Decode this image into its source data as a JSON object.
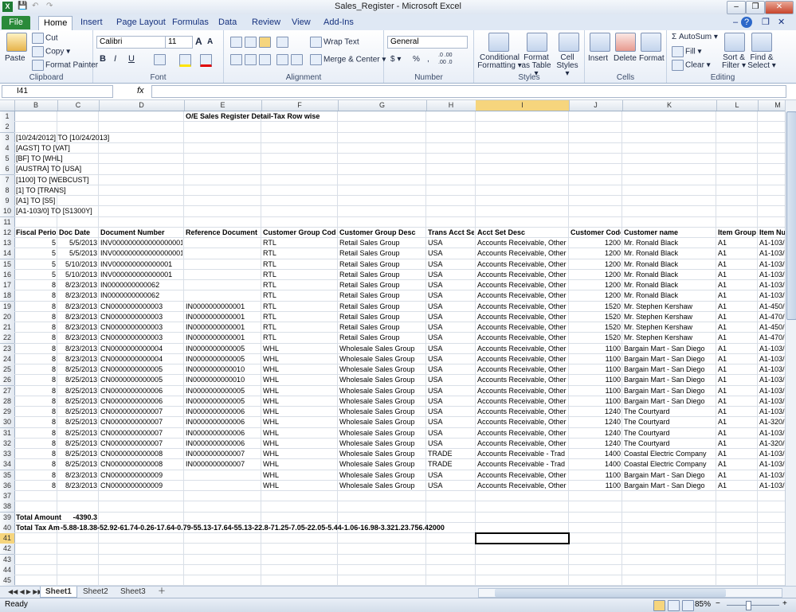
{
  "window": {
    "title": "Sales_Register  -  Microsoft Excel",
    "minimize": "–",
    "restore": "❐",
    "close": "✕",
    "ribbon_min": "–",
    "help": "?",
    "ribbon_restore": "❐",
    "ribbon_close": "✕"
  },
  "tabs": [
    "File",
    "Home",
    "Insert",
    "Page Layout",
    "Formulas",
    "Data",
    "Review",
    "View",
    "Add-Ins"
  ],
  "ribbon": {
    "clipboard": {
      "label": "Clipboard",
      "paste": "Paste",
      "cut": "Cut",
      "copy": "Copy ▾",
      "format_painter": "Format Painter"
    },
    "font": {
      "label": "Font",
      "name": "Calibri",
      "size": "11",
      "grow": "A",
      "shrink": "A",
      "bold": "B",
      "italic": "I",
      "underline": "U"
    },
    "alignment": {
      "label": "Alignment",
      "wrap": "Wrap Text",
      "merge": "Merge & Center ▾"
    },
    "number": {
      "label": "Number",
      "format": "General",
      "currency": "$ ▾",
      "percent": "%",
      "comma": ",",
      "inc_dec": ".0 .00",
      "dec_dec": ".00 .0"
    },
    "styles": {
      "label": "Styles",
      "conditional": "Conditional Formatting ▾",
      "format_table": "Format as Table ▾",
      "cell_styles": "Cell Styles ▾"
    },
    "cells": {
      "label": "Cells",
      "insert": "Insert",
      "delete": "Delete",
      "format": "Format"
    },
    "editing": {
      "label": "Editing",
      "autosum": "Σ AutoSum ▾",
      "fill": "Fill ▾",
      "clear": "Clear ▾",
      "sort": "Sort & Filter ▾",
      "find": "Find & Select ▾"
    }
  },
  "formula_bar": {
    "name_box": "I41",
    "fx": "fx",
    "value": ""
  },
  "columns": [
    "B",
    "C",
    "D",
    "E",
    "F",
    "G",
    "H",
    "I",
    "J",
    "K",
    "L",
    "M"
  ],
  "rows": [
    {
      "n": "1",
      "cells": {
        "E": "O/E Sales Register Detail-Tax Row wise"
      }
    },
    {
      "n": "2",
      "cells": {}
    },
    {
      "n": "3",
      "cells": {
        "B": "[10/24/2012] TO [10/24/2013]"
      }
    },
    {
      "n": "4",
      "cells": {
        "B": "[AGST] TO [VAT]"
      }
    },
    {
      "n": "5",
      "cells": {
        "B": "[BF] TO [WHL]"
      }
    },
    {
      "n": "6",
      "cells": {
        "B": "[AUSTRA] TO [USA]"
      }
    },
    {
      "n": "7",
      "cells": {
        "B": "[1100] TO [WEBCUST]"
      }
    },
    {
      "n": "8",
      "cells": {
        "B": "[1] TO [TRANS]"
      }
    },
    {
      "n": "9",
      "cells": {
        "B": "[A1] TO [S5]"
      }
    },
    {
      "n": "10",
      "cells": {
        "B": "[A1-103/0] TO [S1300Y]"
      }
    },
    {
      "n": "11",
      "cells": {}
    },
    {
      "n": "12",
      "cells": {
        "B": "Fiscal Period",
        "C": "Doc Date",
        "D": "Document Number",
        "E": "Reference Document Nu",
        "F": "Customer Group Code",
        "G": "Customer Group Desc",
        "H": "Trans Acct Set",
        "I": "Acct Set Desc",
        "J": "Customer Code",
        "K": "Customer name",
        "L": "Item Group",
        "M": "Item Nu"
      }
    },
    {
      "n": "13",
      "cells": {
        "B": "5",
        "C": "5/5/2013",
        "D": "INV000000000000000001",
        "E": "",
        "F": "RTL",
        "G": "Retail Sales Group",
        "H": "USA",
        "I": "Accounts Receivable, Other",
        "J": "1200",
        "K": "Mr. Ronald Black",
        "L": "A1",
        "M": "A1-103/"
      }
    },
    {
      "n": "14",
      "cells": {
        "B": "5",
        "C": "5/5/2013",
        "D": "INV000000000000000001",
        "E": "",
        "F": "RTL",
        "G": "Retail Sales Group",
        "H": "USA",
        "I": "Accounts Receivable, Other",
        "J": "1200",
        "K": "Mr. Ronald Black",
        "L": "A1",
        "M": "A1-103/"
      }
    },
    {
      "n": "15",
      "cells": {
        "B": "5",
        "C": "5/10/2013",
        "D": "INV000000000000001",
        "E": "",
        "F": "RTL",
        "G": "Retail Sales Group",
        "H": "USA",
        "I": "Accounts Receivable, Other",
        "J": "1200",
        "K": "Mr. Ronald Black",
        "L": "A1",
        "M": "A1-103/"
      }
    },
    {
      "n": "16",
      "cells": {
        "B": "5",
        "C": "5/10/2013",
        "D": "INV000000000000001",
        "E": "",
        "F": "RTL",
        "G": "Retail Sales Group",
        "H": "USA",
        "I": "Accounts Receivable, Other",
        "J": "1200",
        "K": "Mr. Ronald Black",
        "L": "A1",
        "M": "A1-103/"
      }
    },
    {
      "n": "17",
      "cells": {
        "B": "8",
        "C": "8/23/2013",
        "D": "IN0000000000062",
        "E": "",
        "F": "RTL",
        "G": "Retail Sales Group",
        "H": "USA",
        "I": "Accounts Receivable, Other",
        "J": "1200",
        "K": "Mr. Ronald Black",
        "L": "A1",
        "M": "A1-103/"
      }
    },
    {
      "n": "18",
      "cells": {
        "B": "8",
        "C": "8/23/2013",
        "D": "IN0000000000062",
        "E": "",
        "F": "RTL",
        "G": "Retail Sales Group",
        "H": "USA",
        "I": "Accounts Receivable, Other",
        "J": "1200",
        "K": "Mr. Ronald Black",
        "L": "A1",
        "M": "A1-103/"
      }
    },
    {
      "n": "19",
      "cells": {
        "B": "8",
        "C": "8/23/2013",
        "D": "CN0000000000003",
        "E": "IN0000000000001",
        "F": "RTL",
        "G": "Retail Sales Group",
        "H": "USA",
        "I": "Accounts Receivable, Other",
        "J": "1520",
        "K": "Mr. Stephen Kershaw",
        "L": "A1",
        "M": "A1-450/"
      }
    },
    {
      "n": "20",
      "cells": {
        "B": "8",
        "C": "8/23/2013",
        "D": "CN0000000000003",
        "E": "IN0000000000001",
        "F": "RTL",
        "G": "Retail Sales Group",
        "H": "USA",
        "I": "Accounts Receivable, Other",
        "J": "1520",
        "K": "Mr. Stephen Kershaw",
        "L": "A1",
        "M": "A1-470/"
      }
    },
    {
      "n": "21",
      "cells": {
        "B": "8",
        "C": "8/23/2013",
        "D": "CN0000000000003",
        "E": "IN0000000000001",
        "F": "RTL",
        "G": "Retail Sales Group",
        "H": "USA",
        "I": "Accounts Receivable, Other",
        "J": "1520",
        "K": "Mr. Stephen Kershaw",
        "L": "A1",
        "M": "A1-450/"
      }
    },
    {
      "n": "22",
      "cells": {
        "B": "8",
        "C": "8/23/2013",
        "D": "CN0000000000003",
        "E": "IN0000000000001",
        "F": "RTL",
        "G": "Retail Sales Group",
        "H": "USA",
        "I": "Accounts Receivable, Other",
        "J": "1520",
        "K": "Mr. Stephen Kershaw",
        "L": "A1",
        "M": "A1-470/"
      }
    },
    {
      "n": "23",
      "cells": {
        "B": "8",
        "C": "8/23/2013",
        "D": "CN0000000000004",
        "E": "IN0000000000005",
        "F": "WHL",
        "G": "Wholesale Sales Group",
        "H": "USA",
        "I": "Accounts Receivable, Other",
        "J": "1100",
        "K": "Bargain Mart - San Diego",
        "L": "A1",
        "M": "A1-103/"
      }
    },
    {
      "n": "24",
      "cells": {
        "B": "8",
        "C": "8/23/2013",
        "D": "CN0000000000004",
        "E": "IN0000000000005",
        "F": "WHL",
        "G": "Wholesale Sales Group",
        "H": "USA",
        "I": "Accounts Receivable, Other",
        "J": "1100",
        "K": "Bargain Mart - San Diego",
        "L": "A1",
        "M": "A1-103/"
      }
    },
    {
      "n": "25",
      "cells": {
        "B": "8",
        "C": "8/25/2013",
        "D": "CN0000000000005",
        "E": "IN0000000000010",
        "F": "WHL",
        "G": "Wholesale Sales Group",
        "H": "USA",
        "I": "Accounts Receivable, Other",
        "J": "1100",
        "K": "Bargain Mart - San Diego",
        "L": "A1",
        "M": "A1-103/"
      }
    },
    {
      "n": "26",
      "cells": {
        "B": "8",
        "C": "8/25/2013",
        "D": "CN0000000000005",
        "E": "IN0000000000010",
        "F": "WHL",
        "G": "Wholesale Sales Group",
        "H": "USA",
        "I": "Accounts Receivable, Other",
        "J": "1100",
        "K": "Bargain Mart - San Diego",
        "L": "A1",
        "M": "A1-103/"
      }
    },
    {
      "n": "27",
      "cells": {
        "B": "8",
        "C": "8/25/2013",
        "D": "CN0000000000006",
        "E": "IN0000000000005",
        "F": "WHL",
        "G": "Wholesale Sales Group",
        "H": "USA",
        "I": "Accounts Receivable, Other",
        "J": "1100",
        "K": "Bargain Mart - San Diego",
        "L": "A1",
        "M": "A1-103/"
      }
    },
    {
      "n": "28",
      "cells": {
        "B": "8",
        "C": "8/25/2013",
        "D": "CN0000000000006",
        "E": "IN0000000000005",
        "F": "WHL",
        "G": "Wholesale Sales Group",
        "H": "USA",
        "I": "Accounts Receivable, Other",
        "J": "1100",
        "K": "Bargain Mart - San Diego",
        "L": "A1",
        "M": "A1-103/"
      }
    },
    {
      "n": "29",
      "cells": {
        "B": "8",
        "C": "8/25/2013",
        "D": "CN0000000000007",
        "E": "IN0000000000006",
        "F": "WHL",
        "G": "Wholesale Sales Group",
        "H": "USA",
        "I": "Accounts Receivable, Other",
        "J": "1240",
        "K": "The Courtyard",
        "L": "A1",
        "M": "A1-103/"
      }
    },
    {
      "n": "30",
      "cells": {
        "B": "8",
        "C": "8/25/2013",
        "D": "CN0000000000007",
        "E": "IN0000000000006",
        "F": "WHL",
        "G": "Wholesale Sales Group",
        "H": "USA",
        "I": "Accounts Receivable, Other",
        "J": "1240",
        "K": "The Courtyard",
        "L": "A1",
        "M": "A1-320/"
      }
    },
    {
      "n": "31",
      "cells": {
        "B": "8",
        "C": "8/25/2013",
        "D": "CN0000000000007",
        "E": "IN0000000000006",
        "F": "WHL",
        "G": "Wholesale Sales Group",
        "H": "USA",
        "I": "Accounts Receivable, Other",
        "J": "1240",
        "K": "The Courtyard",
        "L": "A1",
        "M": "A1-103/"
      }
    },
    {
      "n": "32",
      "cells": {
        "B": "8",
        "C": "8/25/2013",
        "D": "CN0000000000007",
        "E": "IN0000000000006",
        "F": "WHL",
        "G": "Wholesale Sales Group",
        "H": "USA",
        "I": "Accounts Receivable, Other",
        "J": "1240",
        "K": "The Courtyard",
        "L": "A1",
        "M": "A1-320/"
      }
    },
    {
      "n": "33",
      "cells": {
        "B": "8",
        "C": "8/25/2013",
        "D": "CN0000000000008",
        "E": "IN0000000000007",
        "F": "WHL",
        "G": "Wholesale Sales Group",
        "H": "TRADE",
        "I": "Accounts Receivable - Trad",
        "J": "1400",
        "K": "Coastal Electric Company",
        "L": "A1",
        "M": "A1-103/"
      }
    },
    {
      "n": "34",
      "cells": {
        "B": "8",
        "C": "8/25/2013",
        "D": "CN0000000000008",
        "E": "IN0000000000007",
        "F": "WHL",
        "G": "Wholesale Sales Group",
        "H": "TRADE",
        "I": "Accounts Receivable - Trad",
        "J": "1400",
        "K": "Coastal Electric Company",
        "L": "A1",
        "M": "A1-103/"
      }
    },
    {
      "n": "35",
      "cells": {
        "B": "8",
        "C": "8/23/2013",
        "D": "CN0000000000009",
        "E": "",
        "F": "WHL",
        "G": "Wholesale Sales Group",
        "H": "USA",
        "I": "Accounts Receivable, Other",
        "J": "1100",
        "K": "Bargain Mart - San Diego",
        "L": "A1",
        "M": "A1-103/"
      }
    },
    {
      "n": "36",
      "cells": {
        "B": "8",
        "C": "8/23/2013",
        "D": "CN0000000000009",
        "E": "",
        "F": "WHL",
        "G": "Wholesale Sales Group",
        "H": "USA",
        "I": "Accounts Receivable, Other",
        "J": "1100",
        "K": "Bargain Mart - San Diego",
        "L": "A1",
        "M": "A1-103/"
      }
    },
    {
      "n": "37",
      "cells": {}
    },
    {
      "n": "38",
      "cells": {}
    },
    {
      "n": "39",
      "cells": {
        "B": "Total Amount",
        "C": "-4390.3"
      }
    },
    {
      "n": "40",
      "cells": {
        "B": "Total Tax Am",
        "C": "-5.88-18.38-52.92-61.74-0.26-17.64-0.79-55.13-17.64-55.13-22.8-71.25-7.05-22.05-5.44-1.06-16.98-3.321.23.756.42000"
      }
    },
    {
      "n": "41",
      "cells": {}
    },
    {
      "n": "42",
      "cells": {}
    },
    {
      "n": "43",
      "cells": {}
    },
    {
      "n": "44",
      "cells": {}
    },
    {
      "n": "45",
      "cells": {}
    }
  ],
  "selected": {
    "col": "I",
    "row": "41"
  },
  "sheets": [
    "Sheet1",
    "Sheet2",
    "Sheet3"
  ],
  "status": {
    "ready": "Ready",
    "zoom": "85%",
    "zoom_minus": "−",
    "zoom_plus": "+"
  }
}
